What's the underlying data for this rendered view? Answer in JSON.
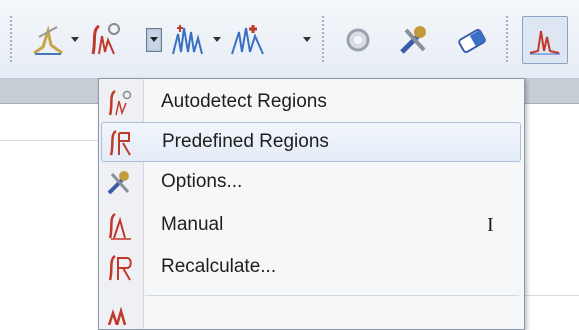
{
  "toolbar": {
    "buttons": [
      {
        "icon": "peak-pick-icon"
      },
      {
        "icon": "integrate-region-icon"
      },
      {
        "icon": "multiplet-icon"
      },
      {
        "icon": "peak-add-icon"
      },
      {
        "icon": "settings-gear-icon"
      },
      {
        "icon": "tools-icon"
      },
      {
        "icon": "eraser-icon"
      },
      {
        "icon": "spectrum-view-icon"
      }
    ]
  },
  "menu": {
    "items": [
      {
        "label": "Autodetect Regions",
        "icon": "autodetect-integral-icon",
        "shortcut": ""
      },
      {
        "label": "Predefined Regions",
        "icon": "predefined-integral-icon",
        "shortcut": ""
      },
      {
        "label": "Options...",
        "icon": "options-tools-icon",
        "shortcut": ""
      },
      {
        "label": "Manual",
        "icon": "manual-integral-icon",
        "shortcut": "I"
      },
      {
        "label": "Recalculate...",
        "icon": "recalculate-integral-icon",
        "shortcut": ""
      }
    ],
    "highlighted_index": 1
  },
  "colors": {
    "accent": "#c0392b",
    "menu_bg": "#f6f7f9",
    "highlight": "#e4ecf7"
  }
}
